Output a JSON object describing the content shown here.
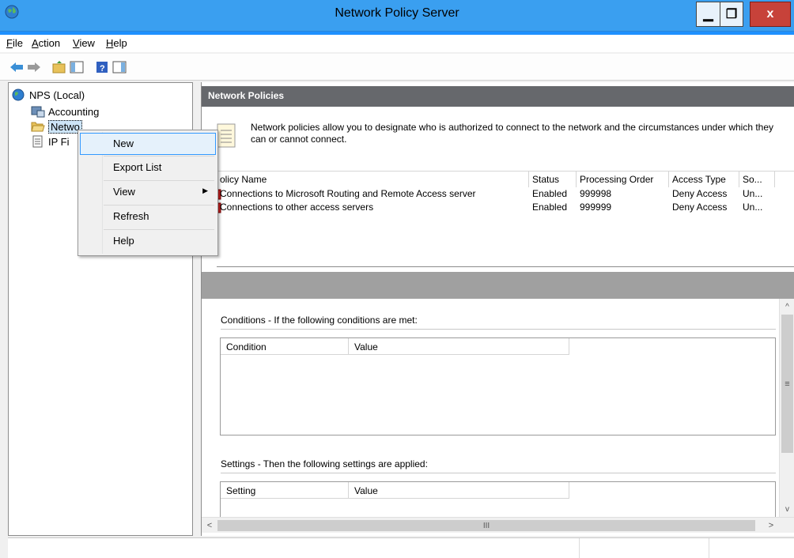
{
  "window": {
    "title": "Network Policy Server",
    "minimize_glyph": "▁",
    "maximize_glyph": "❐",
    "close_glyph": "x"
  },
  "menu": {
    "file": "F",
    "file_rest": "ile",
    "action": "A",
    "action_rest": "ction",
    "view": "V",
    "view_rest": "iew",
    "help": "H",
    "help_rest": "elp"
  },
  "toolbar": {
    "icons": [
      "back-arrow-icon",
      "forward-arrow-icon",
      "up-folder-icon",
      "show-hide-console-tree-icon",
      "help-icon",
      "show-hide-action-pane-icon"
    ]
  },
  "tree": {
    "root": "NPS (Local)",
    "items": [
      "Accounting",
      "Network Policies",
      "IP Filters"
    ],
    "visible_items": [
      "Accounting",
      "Netwo",
      "IP Fi"
    ]
  },
  "main": {
    "header": "Network Policies",
    "description": "Network policies allow you to designate who is authorized to connect to the network and the circumstances under which they can or cannot connect.",
    "columns": [
      "olicy Name",
      "Status",
      "Processing Order",
      "Access Type",
      "So..."
    ],
    "rows": [
      {
        "name": "Connections to Microsoft Routing and Remote Access server",
        "status": "Enabled",
        "order": "999998",
        "access": "Deny Access",
        "source": "Un..."
      },
      {
        "name": "Connections to other access servers",
        "status": "Enabled",
        "order": "999999",
        "access": "Deny Access",
        "source": "Un..."
      }
    ]
  },
  "details": {
    "conditions_label": "Conditions - If the following conditions are met:",
    "conditions_columns": [
      "Condition",
      "Value"
    ],
    "settings_label": "Settings - Then the following settings are applied:",
    "settings_columns": [
      "Setting",
      "Value"
    ],
    "scroll_up": "^",
    "scroll_down": "v",
    "scroll_grip": "≡",
    "scroll_left": "<",
    "scroll_right": ">",
    "hscroll_grip": "III"
  },
  "context_menu": {
    "items": [
      "New",
      "Export List",
      "View",
      "Refresh",
      "Help"
    ],
    "highlighted": "New",
    "submenu_arrow": "▶"
  },
  "colors": {
    "titlebar": "#3a9ff0",
    "header_band": "#66686c",
    "highlight": "#e5f1fb",
    "close_button": "#c7423a"
  }
}
